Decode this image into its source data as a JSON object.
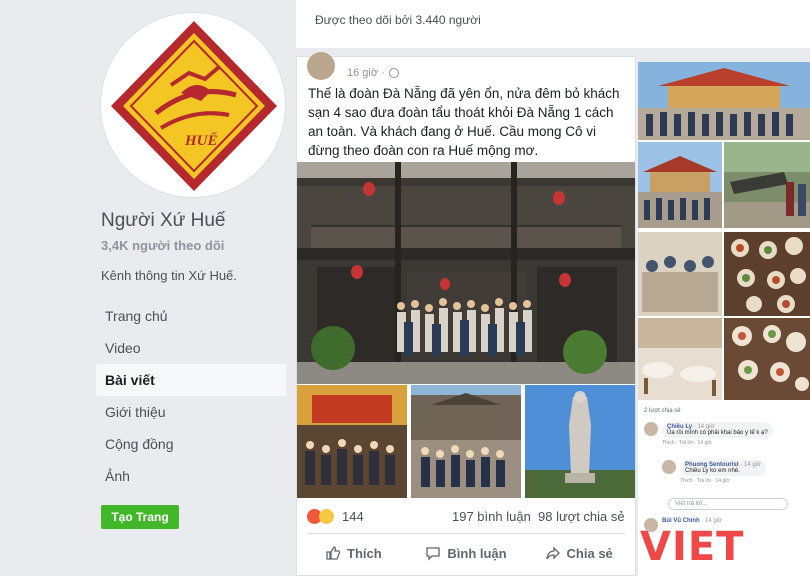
{
  "follow_box": {
    "text": "Được theo dõi bởi 3.440 người"
  },
  "page": {
    "name": "Người Xứ Huế",
    "followers": "3,4K người theo dõi",
    "description": "Kênh thông tin Xứ Huế.",
    "logo_text": "HUẾ",
    "create_page_label": "Tạo Trang"
  },
  "nav": [
    {
      "label": "Trang chủ",
      "active": false
    },
    {
      "label": "Video",
      "active": false
    },
    {
      "label": "Bài viết",
      "active": true
    },
    {
      "label": "Giới thiệu",
      "active": false
    },
    {
      "label": "Cộng đồng",
      "active": false
    },
    {
      "label": "Ảnh",
      "active": false
    }
  ],
  "post": {
    "time": "16 giờ ·",
    "text": "Thế là đoàn Đà Nẵng đã yên ổn, nửa đêm bỏ khách sạn 4 sao đưa đoàn tẩu thoát khỏi Đà Nẵng 1 cách an toàn. Và khách đang ở Huế. Cầu mong Cô vi đừng theo đoàn con ra Huế mộng mơ.",
    "reactions": "144",
    "comments": "197 bình luận",
    "shares": "98 lượt chia sẻ",
    "actions": {
      "like": "Thích",
      "comment": "Bình luận",
      "share": "Chia sẻ"
    }
  },
  "side_comments": {
    "label": "2 lượt chia sẻ",
    "items": [
      {
        "name": "Chiều Ly",
        "meta": "· 14 giờ",
        "text": "Ủa rồi mình có phải khai báo y tế k ạ?",
        "actions": "Thích · Trả lời · 14 giờ"
      },
      {
        "name": "Phuong Sentourist",
        "meta": "· 14 giờ",
        "text": "Chiều Ly ko em nhé.",
        "actions": "Thích · Trả lời · 14 giờ"
      },
      {
        "name": "Bùi Vũ Chính",
        "meta": "· 14 giờ",
        "text": "",
        "actions": ""
      }
    ],
    "reply_placeholder": "Viết trả lời..."
  },
  "watermark": {
    "text": "VIET",
    "small": "VIET"
  },
  "colors": {
    "like_green": "#42b72a",
    "reaction_red": "#f0573b",
    "logo_red": "#b5282e",
    "logo_gold": "#f3c623",
    "watermark_red": "#eb2828"
  }
}
